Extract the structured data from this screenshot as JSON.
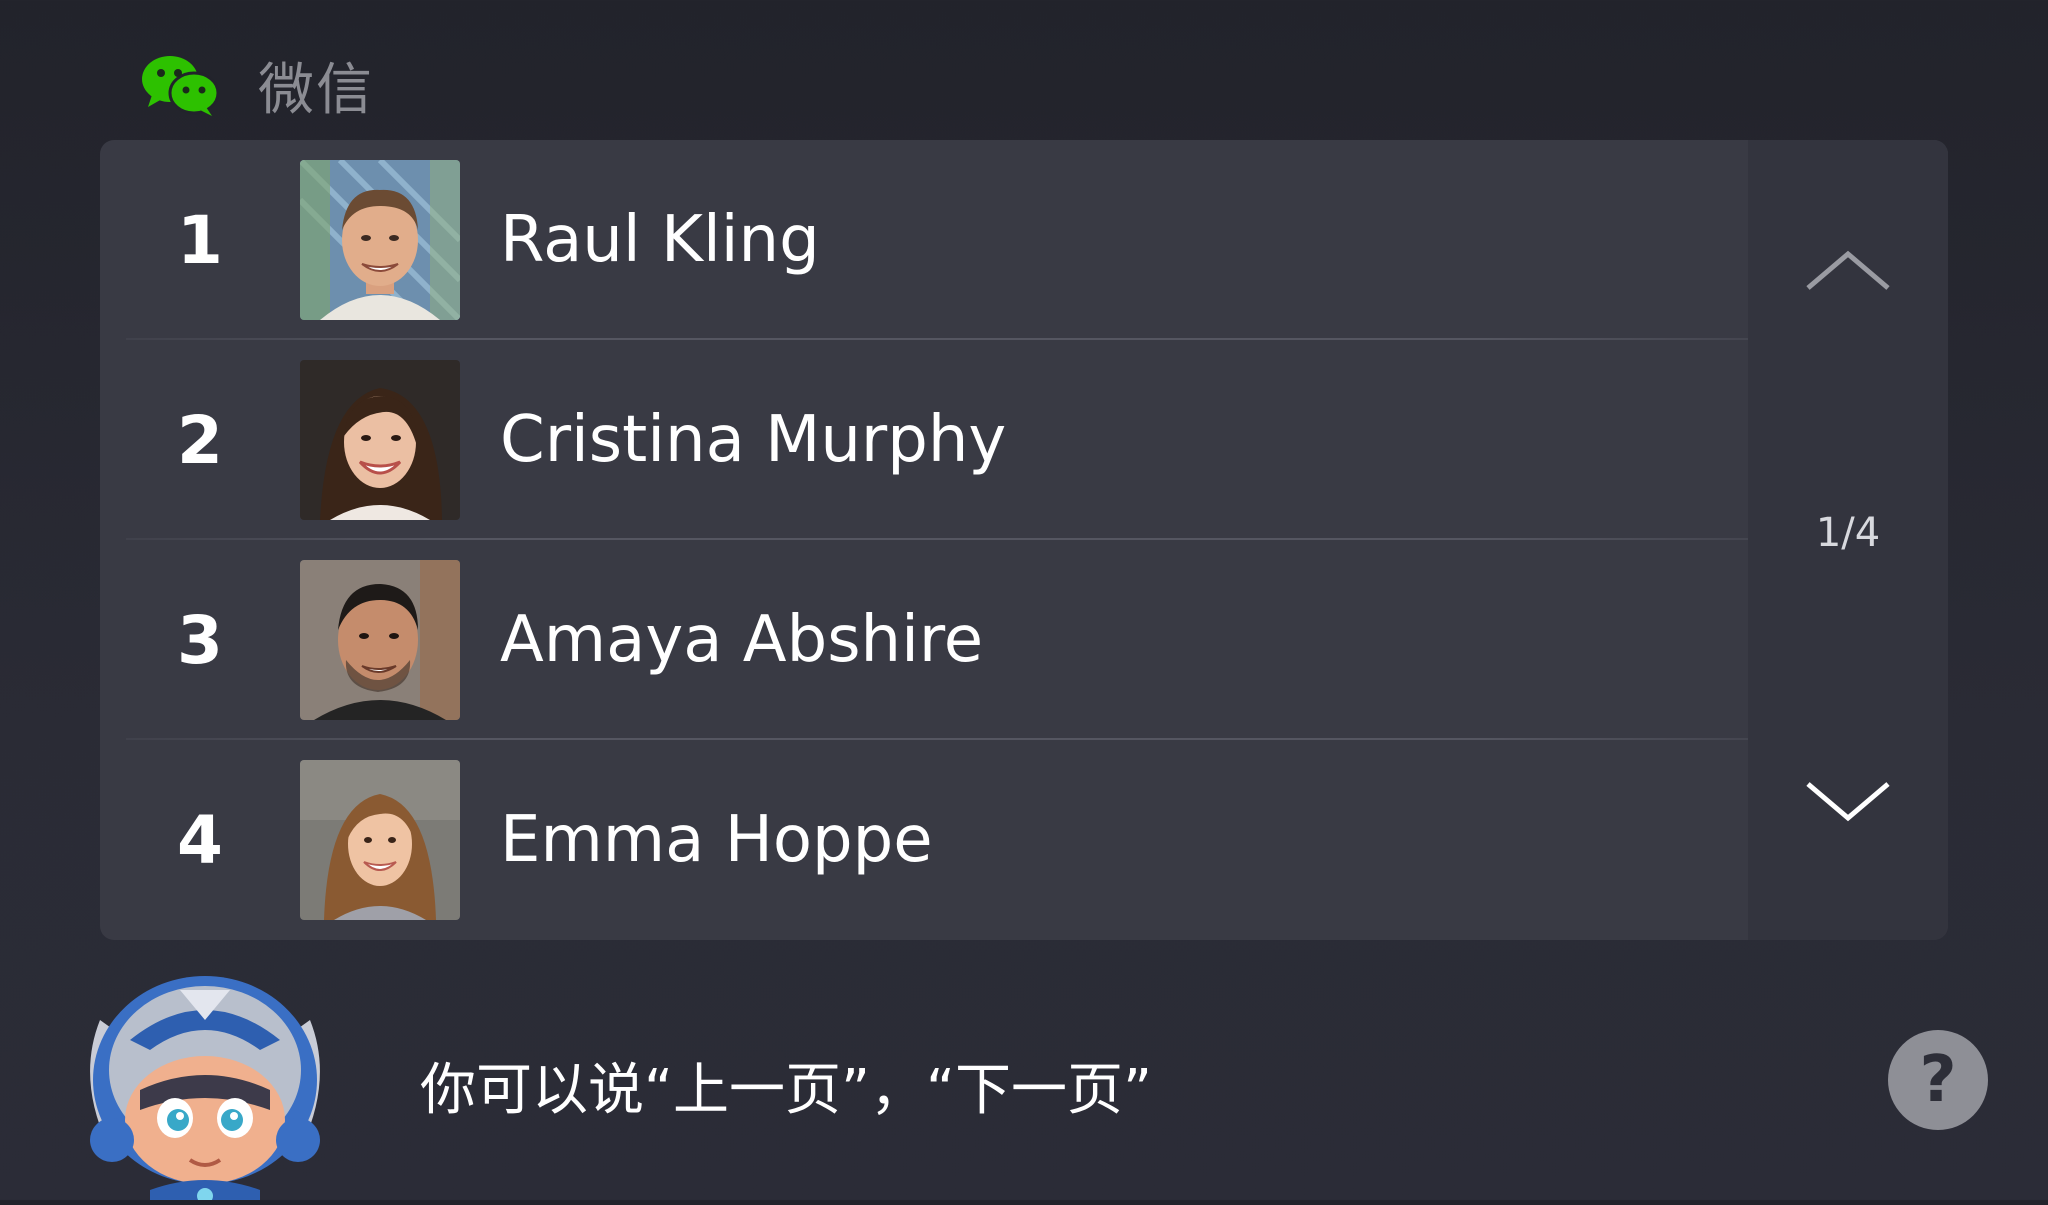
{
  "header": {
    "app_icon": "wechat-icon",
    "title": "微信"
  },
  "contacts": [
    {
      "index": "1",
      "name": "Raul Kling",
      "avatar": "photo-young-man-smiling"
    },
    {
      "index": "2",
      "name": "Cristina Murphy",
      "avatar": "photo-woman-dark-hair-smiling"
    },
    {
      "index": "3",
      "name": "Amaya Abshire",
      "avatar": "photo-man-stubble-smiling"
    },
    {
      "index": "4",
      "name": "Emma Hoppe",
      "avatar": "photo-woman-brown-hair-smiling"
    }
  ],
  "pager": {
    "up_icon": "chevron-up-icon",
    "down_icon": "chevron-down-icon",
    "page_label": "1/4"
  },
  "footer": {
    "mascot": "robot-helmet-mascot",
    "hint": "你可以说“上一页”，“下一页”",
    "help_label": "?"
  },
  "colors": {
    "wechat_green": "#2dc100",
    "background": "#24252d",
    "panel": "#393a44"
  }
}
